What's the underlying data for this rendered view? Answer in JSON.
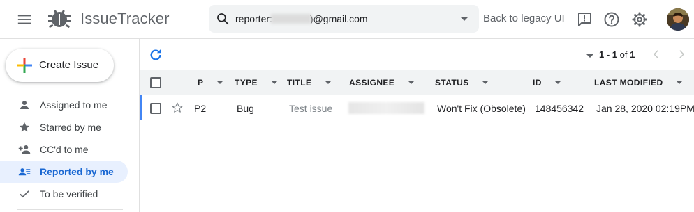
{
  "header": {
    "app_title": "IssueTracker",
    "search": {
      "prefix": "reporter:",
      "suffix": ")@gmail.com"
    },
    "legacy_link": "Back to legacy UI"
  },
  "sidebar": {
    "create_label": "Create Issue",
    "items": [
      {
        "label": "Assigned to me",
        "icon": "person-icon"
      },
      {
        "label": "Starred by me",
        "icon": "star-icon"
      },
      {
        "label": "CC'd to me",
        "icon": "person-add-icon"
      },
      {
        "label": "Reported by me",
        "icon": "reported-icon",
        "active": true
      },
      {
        "label": "To be verified",
        "icon": "check-icon"
      }
    ]
  },
  "pagination": {
    "range": "1 - 1",
    "of": "of",
    "total": "1"
  },
  "table": {
    "columns": [
      "P",
      "TYPE",
      "TITLE",
      "ASSIGNEE",
      "STATUS",
      "ID",
      "LAST MODIFIED"
    ],
    "rows": [
      {
        "priority": "P2",
        "type": "Bug",
        "title": "Test issue",
        "status": "Won't Fix (Obsolete)",
        "id": "148456342",
        "last_modified": "Jan 28, 2020 02:19PM"
      }
    ]
  },
  "colors": {
    "accent": "#1a73e8",
    "active_bg": "#e8f0fe",
    "active_text": "#1967d2",
    "row_accent": "#4285f4"
  }
}
